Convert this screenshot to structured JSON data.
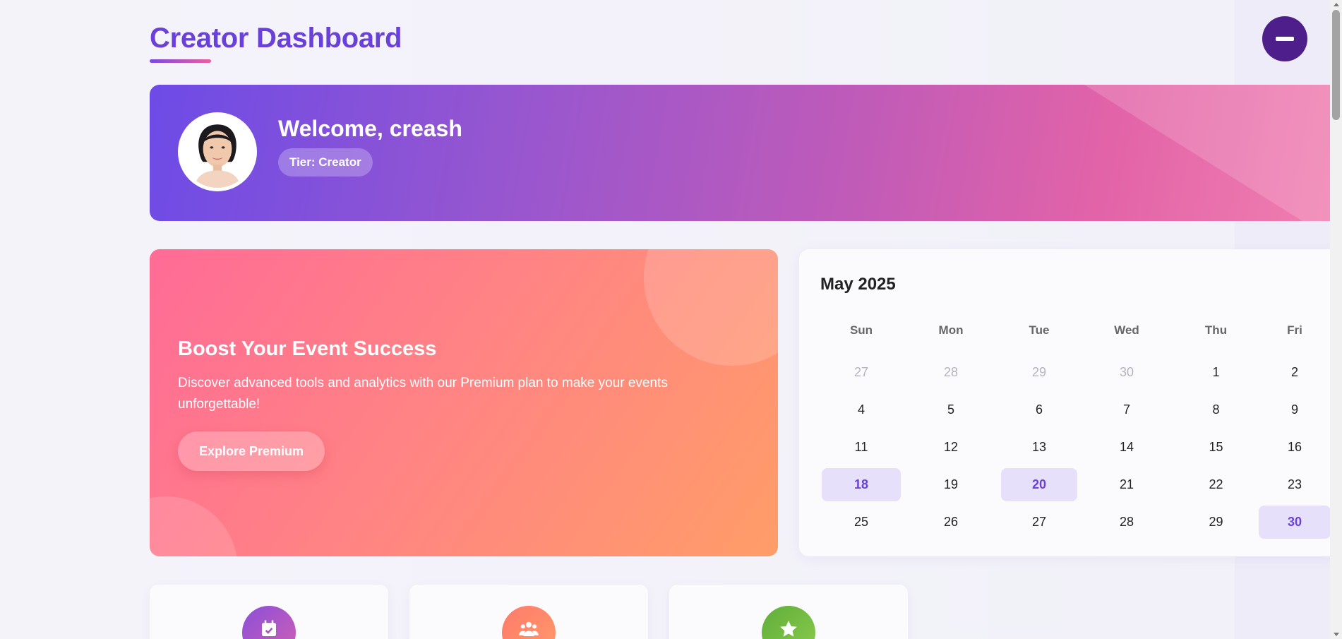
{
  "page": {
    "title": "Creator Dashboard"
  },
  "header": {
    "menu_button_icon": "minus-icon"
  },
  "banner": {
    "welcome": "Welcome, creash",
    "tier": "Tier: Creator",
    "avatar_icon": "profile-photo"
  },
  "promo": {
    "title": "Boost Your Event Success",
    "text": "Discover advanced tools and analytics with our Premium plan to make your events unforgettable!",
    "button": "Explore Premium"
  },
  "calendar": {
    "title": "May 2025",
    "weekdays": [
      "Sun",
      "Mon",
      "Tue",
      "Wed",
      "Thu",
      "Fri"
    ],
    "weeks": [
      [
        {
          "d": "27",
          "muted": true
        },
        {
          "d": "28",
          "muted": true
        },
        {
          "d": "29",
          "muted": true
        },
        {
          "d": "30",
          "muted": true
        },
        {
          "d": "1"
        },
        {
          "d": "2"
        }
      ],
      [
        {
          "d": "4"
        },
        {
          "d": "5"
        },
        {
          "d": "6"
        },
        {
          "d": "7"
        },
        {
          "d": "8"
        },
        {
          "d": "9"
        }
      ],
      [
        {
          "d": "11"
        },
        {
          "d": "12"
        },
        {
          "d": "13"
        },
        {
          "d": "14"
        },
        {
          "d": "15"
        },
        {
          "d": "16"
        }
      ],
      [
        {
          "d": "18",
          "marked": true
        },
        {
          "d": "19"
        },
        {
          "d": "20",
          "marked": true
        },
        {
          "d": "21"
        },
        {
          "d": "22"
        },
        {
          "d": "23"
        }
      ],
      [
        {
          "d": "25"
        },
        {
          "d": "26"
        },
        {
          "d": "27"
        },
        {
          "d": "28"
        },
        {
          "d": "29"
        },
        {
          "d": "30",
          "marked": true
        }
      ]
    ]
  },
  "stats": [
    {
      "icon": "calendar-check-icon",
      "color_from": "#8b4fd8",
      "color_to": "#d15fb4"
    },
    {
      "icon": "users-icon",
      "color_from": "#ff7a6a",
      "color_to": "#ff9b6b"
    },
    {
      "icon": "star-icon",
      "color_from": "#5fae3a",
      "color_to": "#8ccc4e"
    }
  ],
  "colors": {
    "accent": "#6a41d8",
    "marked_bg": "#e6e0fb"
  }
}
